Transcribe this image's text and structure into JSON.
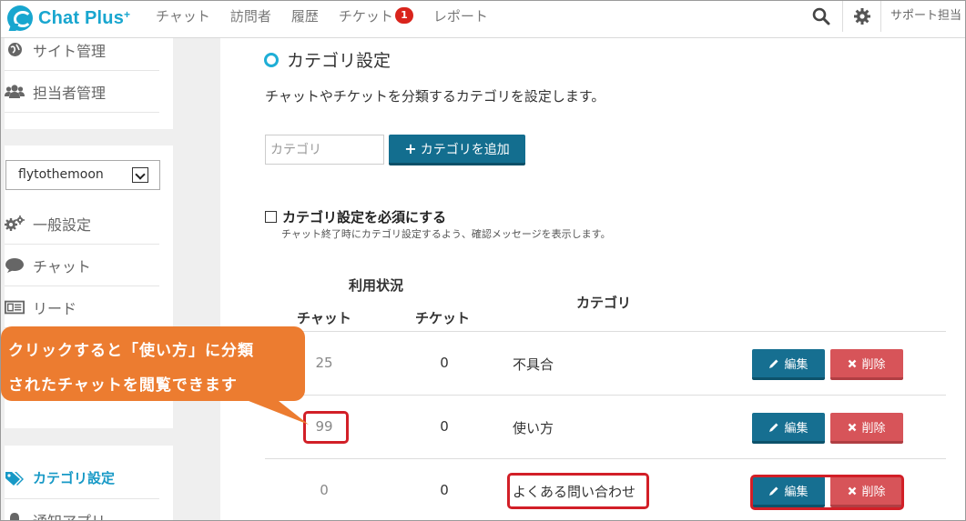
{
  "app": {
    "name": "Chat Plus",
    "plus": "+"
  },
  "nav": [
    {
      "label": "チャット"
    },
    {
      "label": "訪問者"
    },
    {
      "label": "履歴"
    },
    {
      "label": "チケット",
      "badge": "1"
    },
    {
      "label": "レポート"
    }
  ],
  "topbar": {
    "user_label": "サポート担当"
  },
  "sidebar": {
    "top_items": [
      {
        "label": "サイト管理",
        "icon": "globe-icon"
      },
      {
        "label": "担当者管理",
        "icon": "users-icon"
      }
    ],
    "site_select": {
      "value": "flytothemoon"
    },
    "settings_items": [
      {
        "label": "一般設定",
        "icon": "gears-icon"
      },
      {
        "label": "チャット",
        "icon": "comment-icon"
      },
      {
        "label": "リード",
        "icon": "lead-card-icon"
      }
    ],
    "bottom_items": [
      {
        "label": "カテゴリ設定",
        "icon": "tag-icon",
        "active": true
      },
      {
        "label": "通知アプリ",
        "icon": "bell-icon"
      }
    ]
  },
  "page": {
    "title": "カテゴリ設定",
    "description": "チャットやチケットを分類するカテゴリを設定します。",
    "input_placeholder": "カテゴリ",
    "add_button": "カテゴリを追加",
    "require_label": "カテゴリ設定を必須にする",
    "require_note": "チャット終了時にカテゴリ設定するよう、確認メッセージを表示します。"
  },
  "table": {
    "header_usage": "利用状況",
    "header_chat": "チャット",
    "header_ticket": "チケット",
    "header_category": "カテゴリ",
    "edit_label": "編集",
    "delete_label": "削除",
    "rows": [
      {
        "chat": "25",
        "ticket": "0",
        "category": "不具合"
      },
      {
        "chat": "99",
        "ticket": "0",
        "category": "使い方"
      },
      {
        "chat": "0",
        "ticket": "0",
        "category": "よくある問い合わせ"
      }
    ]
  },
  "callout": {
    "line1": "クリックすると「使い方」に分類",
    "line2": "されたチャットを閲覧できます"
  },
  "colors": {
    "brand": "#18a6cf",
    "edit": "#166f91",
    "delete": "#d75459",
    "highlight": "#d21f27",
    "callout": "#ec7c30"
  }
}
